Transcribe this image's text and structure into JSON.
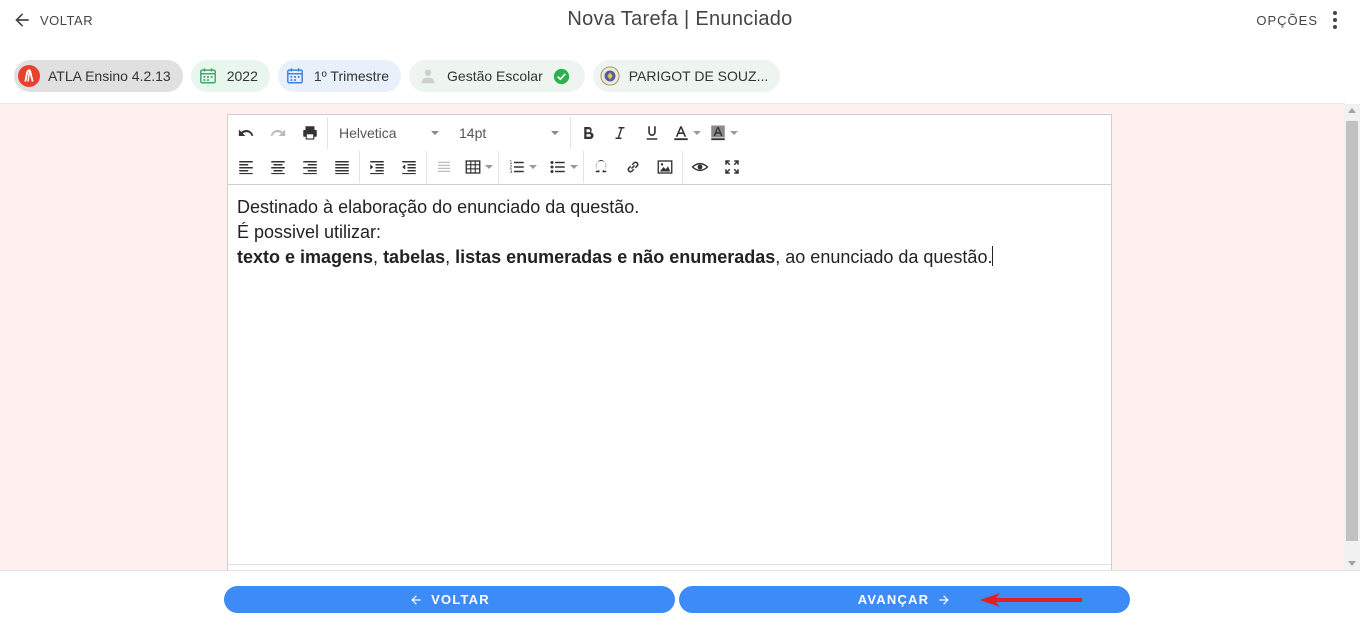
{
  "header": {
    "back_label": "VOLTAR",
    "title": "Nova Tarefa | Enunciado",
    "options_label": "OPÇÕES"
  },
  "chips": {
    "app": "ATLA Ensino 4.2.13",
    "year": "2022",
    "period": "1º Trimestre",
    "role": "Gestão Escolar",
    "school": "PARIGOT DE SOUZ..."
  },
  "toolbar": {
    "font_family": "Helvetica",
    "font_size": "14pt"
  },
  "editor": {
    "line1": "Destinado à elaboração do enunciado da questão.",
    "line2": "É possivel utilizar:",
    "bold1": "texto e imagens",
    "sep1": ", ",
    "bold2": "tabelas",
    "sep2": ", ",
    "bold3": "listas enumeradas e não enumeradas",
    "tail": ", ao enunciado da questão."
  },
  "footer": {
    "back_label": "VOLTAR",
    "next_label": "AVANÇAR"
  },
  "colors": {
    "primary": "#3d8bf7",
    "content_bg": "#fdf0ef",
    "annotation_arrow": "#e02020",
    "success": "#2bb24c"
  }
}
